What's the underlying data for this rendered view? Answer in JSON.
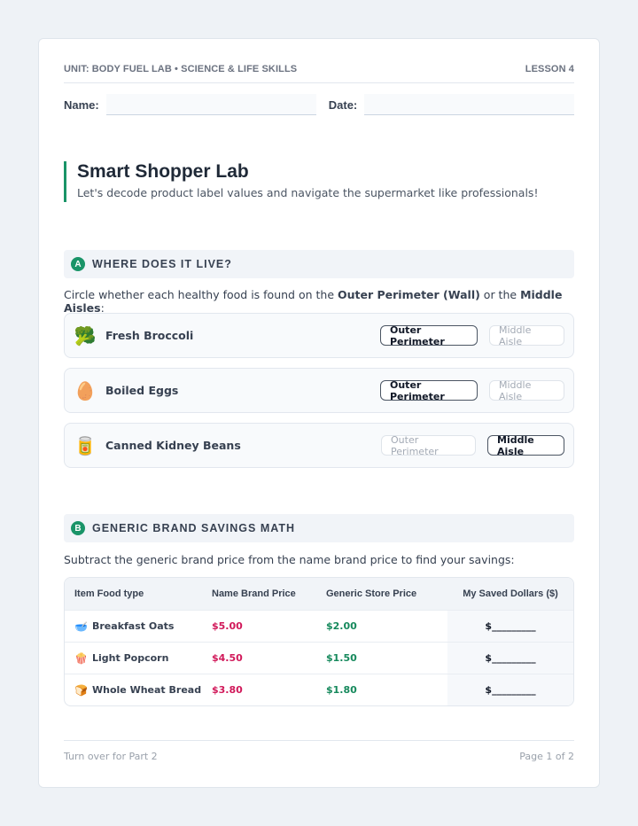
{
  "header": {
    "unit": "UNIT: BODY FUEL LAB • SCIENCE & LIFE SKILLS",
    "lesson": "LESSON 4"
  },
  "student": {
    "name_label": "Name:",
    "date_label": "Date:"
  },
  "title": "Smart Shopper Lab",
  "subtitle": "Let's decode product label values and navigate the supermarket like professionals!",
  "section_a": {
    "letter": "A",
    "title": "WHERE DOES IT LIVE?",
    "instruction_pre": "Circle whether each healthy food is found on the ",
    "instruction_bold1": "Outer Perimeter (Wall)",
    "instruction_mid": " or the ",
    "instruction_bold2": "Middle Aisles",
    "instruction_post": ":",
    "items": [
      {
        "icon": "🥦",
        "name": "Fresh Broccoli",
        "opt1": "Outer Perimeter",
        "opt2": "Middle Aisle",
        "selected": "opt1"
      },
      {
        "icon": "🥚",
        "name": "Boiled Eggs",
        "opt1": "Outer Perimeter",
        "opt2": "Middle Aisle",
        "selected": "opt1"
      },
      {
        "icon": "🥫",
        "name": "Canned Kidney Beans",
        "opt1": "Outer Perimeter",
        "opt2": "Middle Aisle",
        "selected": "opt2"
      }
    ]
  },
  "section_b": {
    "letter": "B",
    "title": "GENERIC BRAND SAVINGS MATH",
    "instruction": "Subtract the generic brand price from the name brand price to find your savings:",
    "columns": [
      "Item Food type",
      "Name Brand Price",
      "Generic Store Price",
      "My Saved Dollars ($)"
    ],
    "rows": [
      {
        "icon": "🥣",
        "item": "Breakfast Oats",
        "name_price": "$5.00",
        "generic_price": "$2.00",
        "saved": "$_________"
      },
      {
        "icon": "🍿",
        "item": "Light Popcorn",
        "name_price": "$4.50",
        "generic_price": "$1.50",
        "saved": "$_________"
      },
      {
        "icon": "🍞",
        "item": "Whole Wheat Bread",
        "name_price": "$3.80",
        "generic_price": "$1.80",
        "saved": "$_________"
      }
    ]
  },
  "footer": {
    "left": "Turn over for Part 2",
    "right": "Page 1 of 2"
  },
  "colors": {
    "accent": "#1a9468",
    "name_price": "#d1195a",
    "generic_price": "#16895c"
  }
}
